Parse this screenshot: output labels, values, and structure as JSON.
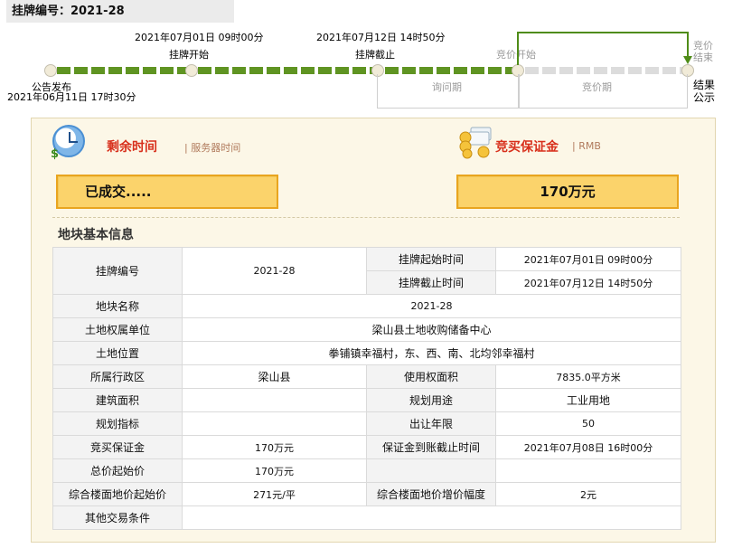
{
  "header": {
    "listing_no": "挂牌编号：2021-28"
  },
  "timeline": {
    "announce_label": "公告发布",
    "announce_time": "2021年06月11日 17时30分",
    "listing_start_time": "2021年07月01日 09时00分",
    "listing_start_label": "挂牌开始",
    "listing_end_time": "2021年07月12日 14时50分",
    "listing_end_label": "挂牌截止",
    "bid_start_label": "竞价开始",
    "bid_end_label": "竞价结束",
    "result_label": "结果公示",
    "inquiry_period": "询问期",
    "bid_period": "竞价期"
  },
  "panel": {
    "remaining_title": "剩余时间",
    "remaining_sub": "| 服务器时间",
    "deposit_title": "竞买保证金",
    "deposit_sub": "| RMB",
    "status_value": "已成交.....",
    "deposit_value": "170万元",
    "dollar_symbol": "$",
    "info_title": "地块基本信息"
  },
  "table": {
    "listing_no_label": "挂牌编号",
    "listing_no": "2021-28",
    "listing_start_label": "挂牌起始时间",
    "listing_start": "2021年07月01日 09时00分",
    "listing_end_label": "挂牌截止时间",
    "listing_end": "2021年07月12日 14时50分",
    "parcel_name_label": "地块名称",
    "parcel_name": "2021-28",
    "owner_label": "土地权属单位",
    "owner": "梁山县土地收购储备中心",
    "location_label": "土地位置",
    "location": "拳铺镇幸福村，东、西、南、北均邻幸福村",
    "district_label": "所属行政区",
    "district": "梁山县",
    "area_label": "使用权面积",
    "area": "7835.0平方米",
    "building_area_label": "建筑面积",
    "building_area": "",
    "usage_label": "规划用途",
    "usage": "工业用地",
    "plan_index_label": "规划指标",
    "plan_index": "",
    "term_label": "出让年限",
    "term": "50",
    "deposit_label": "竞买保证金",
    "deposit": "170万元",
    "deposit_deadline_label": "保证金到账截止时间",
    "deposit_deadline": "2021年07月08日 16时00分",
    "start_price_label": "总价起始价",
    "start_price": "170万元",
    "floor_price_label": "综合楼面地价起始价",
    "floor_price": "271元/平",
    "increment_label": "综合楼面地价增价幅度",
    "increment": "2元",
    "other_label": "其他交易条件",
    "other": ""
  },
  "colors": {
    "green": "#5f9422",
    "accent_red": "#d8301c",
    "box_fill": "#fbd36b",
    "box_border": "#e9a51f"
  }
}
